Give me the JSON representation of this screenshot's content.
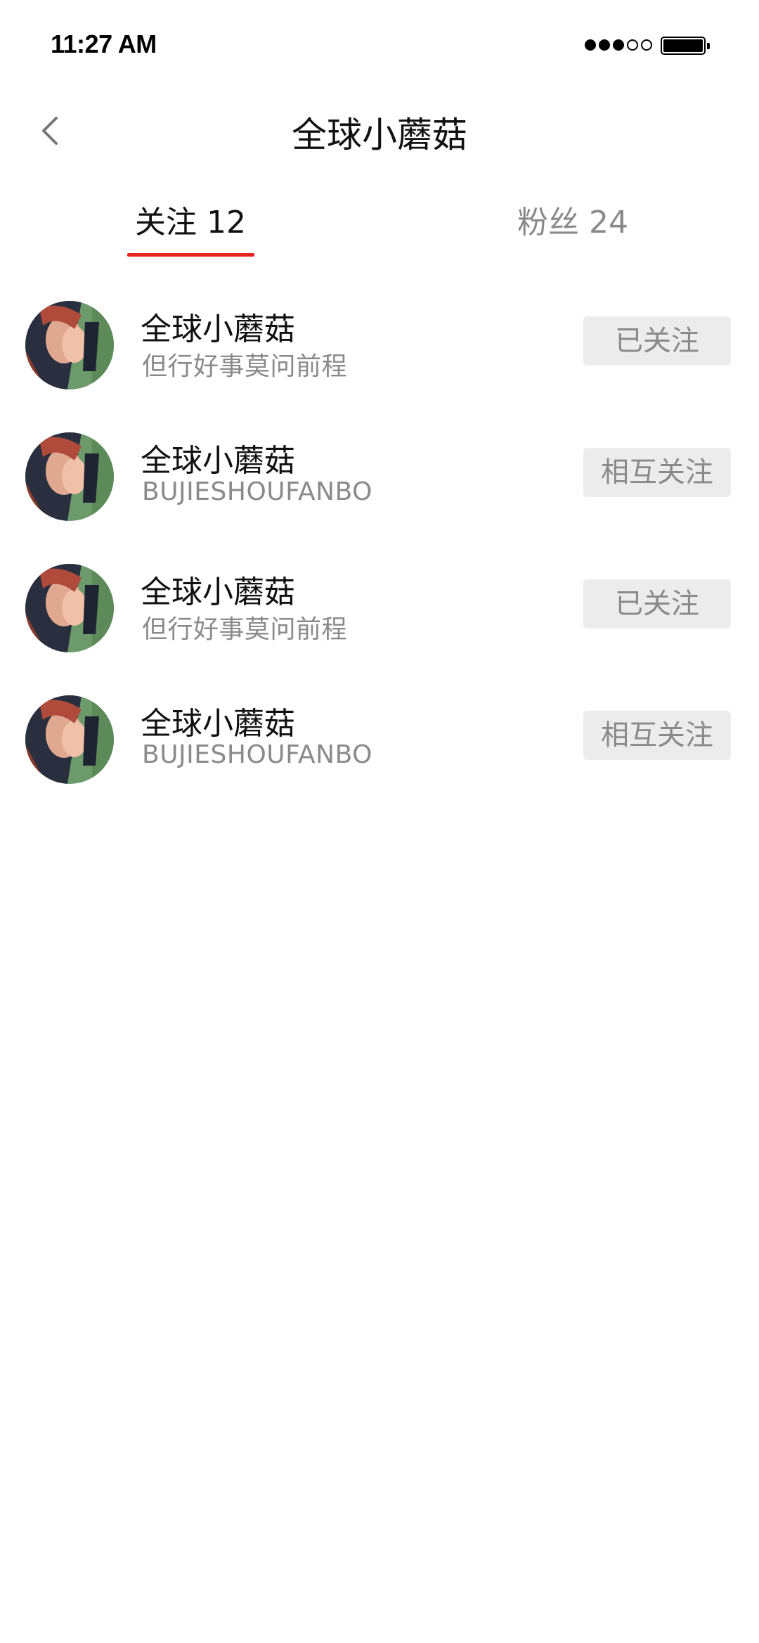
{
  "status_bar": {
    "time": "11:27 AM",
    "signal_icon": "signal-dots-icon",
    "battery_icon": "battery-icon"
  },
  "nav": {
    "back_icon": "chevron-left-icon",
    "title": "全球小蘑菇"
  },
  "tabs": {
    "following_label": "关注 12",
    "followers_label": "粉丝 24",
    "active": "following",
    "accent_color": "#e8231f"
  },
  "users": [
    {
      "name": "全球小蘑菇",
      "subtitle": "但行好事莫问前程",
      "action": "已关注"
    },
    {
      "name": "全球小蘑菇",
      "subtitle": "BUJIESHOUFANBO",
      "action": "相互关注"
    },
    {
      "name": "全球小蘑菇",
      "subtitle": "但行好事莫问前程",
      "action": "已关注"
    },
    {
      "name": "全球小蘑菇",
      "subtitle": "BUJIESHOUFANBO",
      "action": "相互关注"
    }
  ]
}
